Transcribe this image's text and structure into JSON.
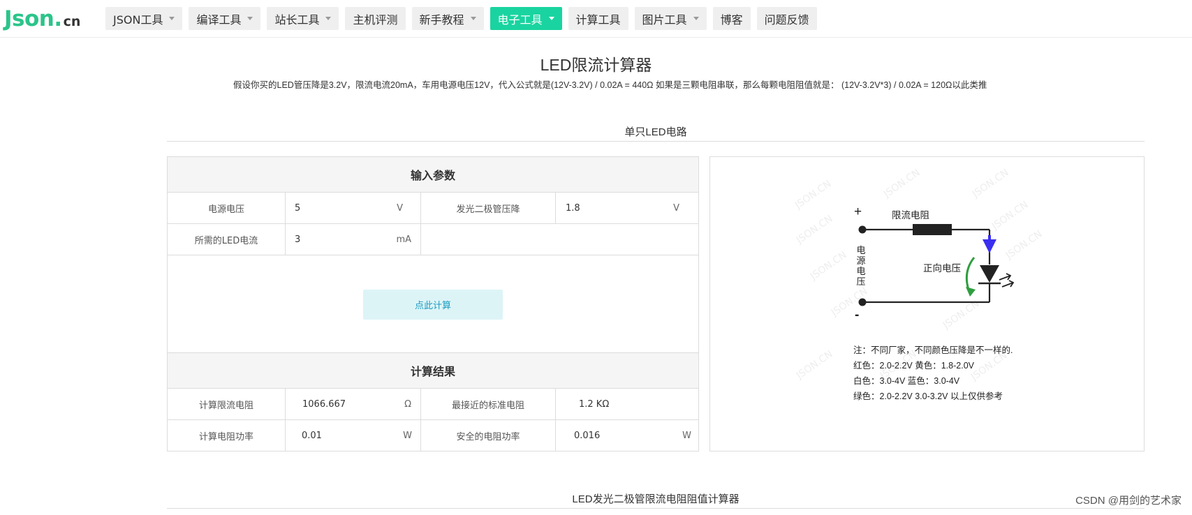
{
  "logo": {
    "main": "Json.",
    "tld": "cn"
  },
  "nav": [
    {
      "label": "JSON工具",
      "dropdown": true,
      "active": false
    },
    {
      "label": "编译工具",
      "dropdown": true,
      "active": false
    },
    {
      "label": "站长工具",
      "dropdown": true,
      "active": false
    },
    {
      "label": "主机评测",
      "dropdown": false,
      "active": false
    },
    {
      "label": "新手教程",
      "dropdown": true,
      "active": false
    },
    {
      "label": "电子工具",
      "dropdown": true,
      "active": true
    },
    {
      "label": "计算工具",
      "dropdown": false,
      "active": false
    },
    {
      "label": "图片工具",
      "dropdown": true,
      "active": false
    },
    {
      "label": "博客",
      "dropdown": false,
      "active": false
    },
    {
      "label": "问题反馈",
      "dropdown": false,
      "active": false
    }
  ],
  "page": {
    "title": "LED限流计算器",
    "subtitle": "假设你买的LED管压降是3.2V，限流电流20mA，车用电源电压12V，代入公式就是(12V-3.2V) / 0.02A = 440Ω 如果是三颗电阻串联，那么每颗电阻阻值就是： (12V-3.2V*3) / 0.02A = 120Ω以此类推",
    "section1": "单只LED电路",
    "section2": "LED发光二极管限流电阻阻值计算器"
  },
  "inputs": {
    "header": "输入参数",
    "supply_label": "电源电压",
    "supply_value": "5",
    "supply_unit": "V",
    "drop_label": "发光二极管压降",
    "drop_value": "1.8",
    "drop_unit": "V",
    "current_label": "所需的LED电流",
    "current_value": "3",
    "current_unit": "mA"
  },
  "calculate_button": "点此计算",
  "results": {
    "header": "计算结果",
    "resistance_label": "计算限流电阻",
    "resistance_value": "1066.667",
    "resistance_unit": "Ω",
    "nearest_label": "最接近的标准电阻",
    "nearest_value": "1.2 KΩ",
    "power_label": "计算电阻功率",
    "power_value": "0.01",
    "power_unit": "W",
    "safe_power_label": "安全的电阻功率",
    "safe_power_value": "0.016",
    "safe_power_unit": "W"
  },
  "diagram": {
    "plus": "+",
    "minus": "-",
    "resistor_label": "限流电阻",
    "forward_label": "正向电压",
    "supply_vertical": [
      "电",
      "源",
      "电",
      "压"
    ],
    "notes": [
      "注：不同厂家，不同颜色压降是不一样的.",
      "红色：2.0-2.2V 黄色：1.8-2.0V",
      "白色：3.0-4V 蓝色：3.0-4V",
      "绿色：2.0-2.2V 3.0-3.2V 以上仅供参考"
    ],
    "watermark": "JSON.CN",
    "colors": {
      "wire": "#222222",
      "arrow_blue": "#3a2ff0",
      "arrow_green": "#2e9e3e"
    }
  },
  "footer_watermark": "CSDN @用剑的艺术家"
}
